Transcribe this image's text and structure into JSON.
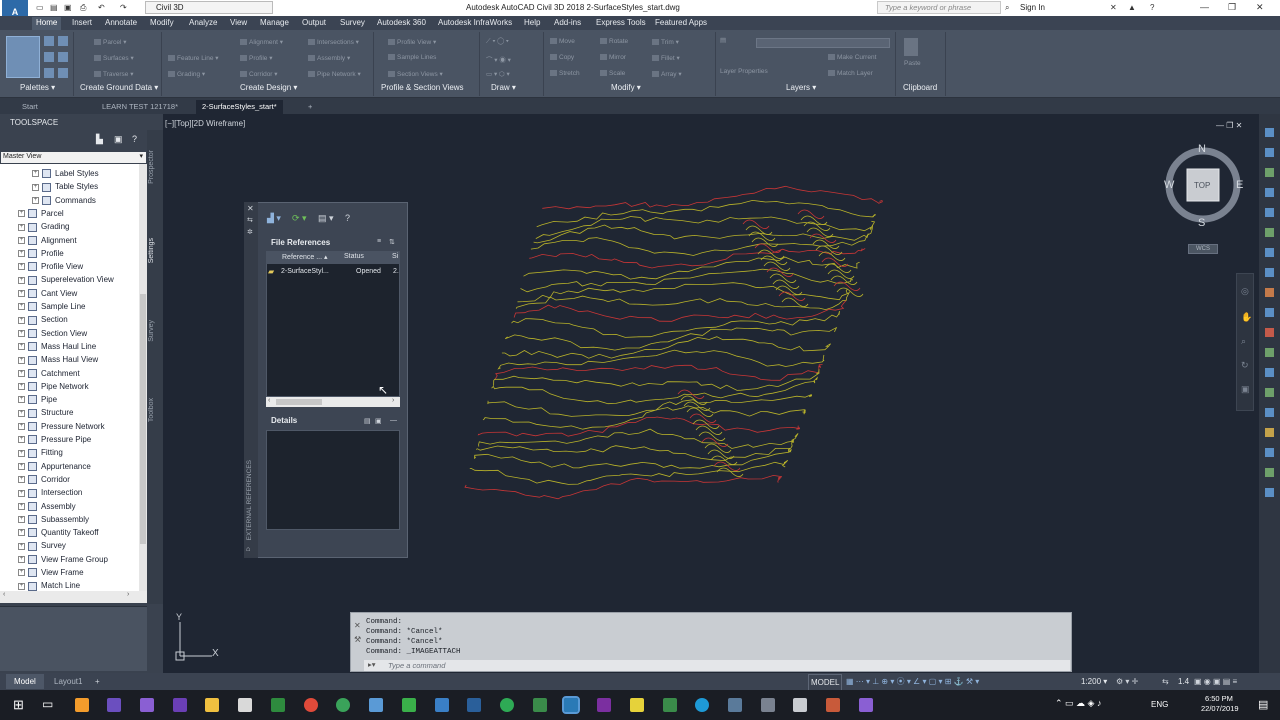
{
  "titlebar": {
    "logo": "A",
    "logo_sub": "CIVIL",
    "workspace": "Civil 3D",
    "title": "Autodesk AutoCAD Civil 3D 2018    2-SurfaceStyles_start.dwg",
    "search_placeholder": "Type a keyword or phrase",
    "sign_in": "Sign In"
  },
  "menu": {
    "tabs": [
      "Home",
      "Insert",
      "Annotate",
      "Modify",
      "Analyze",
      "View",
      "Manage",
      "Output",
      "Survey",
      "Autodesk 360",
      "Autodesk InfraWorks",
      "Help",
      "Add-ins",
      "Express Tools",
      "Featured Apps"
    ]
  },
  "ribbon": {
    "buttons_1": [
      "Parcel",
      "Surfaces",
      "Traverse"
    ],
    "buttons_2": [
      "Feature Line",
      "Grading"
    ],
    "buttons_3": [
      "Alignment",
      "Profile",
      "Corridor"
    ],
    "buttons_4": [
      "Intersections",
      "Assembly",
      "Pipe Network"
    ],
    "buttons_5": [
      "Profile View",
      "Sample Lines",
      "Section Views"
    ],
    "buttons_modify": [
      "Move",
      "Copy",
      "Stretch",
      "Rotate",
      "Mirror",
      "Scale",
      "Trim",
      "Fillet",
      "Array"
    ],
    "buttons_layers": [
      "Make Current",
      "Match Layer"
    ],
    "layer_props": "Layer Properties",
    "paste": "Paste",
    "panels": [
      "Palettes",
      "Create Ground Data",
      "Create Design",
      "Profile & Section Views",
      "Draw",
      "Modify",
      "Layers",
      "Clipboard"
    ]
  },
  "doc_tabs": [
    "Start",
    "LEARN TEST 121718*",
    "2-SurfaceStyles_start*"
  ],
  "toolspace": {
    "title": "TOOLSPACE",
    "view": "Master View",
    "items": [
      "Label Styles",
      "Table Styles",
      "Commands",
      "Parcel",
      "Grading",
      "Alignment",
      "Profile",
      "Profile View",
      "Superelevation View",
      "Cant View",
      "Sample Line",
      "Section",
      "Section View",
      "Mass Haul Line",
      "Mass Haul View",
      "Catchment",
      "Pipe Network",
      "Pipe",
      "Structure",
      "Pressure Network",
      "Pressure Pipe",
      "Fitting",
      "Appurtenance",
      "Corridor",
      "Intersection",
      "Assembly",
      "Subassembly",
      "Quantity Takeoff",
      "Survey",
      "View Frame Group",
      "View Frame",
      "Match Line"
    ],
    "side_tabs": [
      "Prospector",
      "Settings",
      "Survey",
      "Toolbox"
    ]
  },
  "viewport": {
    "label": "[−][Top][2D Wireframe]",
    "cube": {
      "n": "N",
      "s": "S",
      "e": "E",
      "w": "W",
      "top": "TOP"
    },
    "wcs": "WCS",
    "ucs_x": "X",
    "ucs_y": "Y"
  },
  "xref": {
    "title": "EXTERNAL REFERENCES",
    "section": "File References",
    "columns": [
      "Reference ...",
      "Status",
      "Si"
    ],
    "row": {
      "name": "2-SurfaceStyl...",
      "status": "Opened",
      "size": "2."
    },
    "details": "Details"
  },
  "command": {
    "history": [
      "Command:",
      "Command: *Cancel*",
      "Command: *Cancel*",
      "Command: _IMAGEATTACH"
    ],
    "placeholder": "Type a command"
  },
  "status": {
    "tabs": [
      "Model",
      "Layout1"
    ],
    "mode": "MODEL",
    "scale": "1:200",
    "lw": "1.4"
  },
  "taskbar": {
    "lang": "ENG",
    "time": "6:50 PM",
    "date": "22/07/2019"
  },
  "colors": {
    "contour_major": "#c93636",
    "contour_minor": "#b9b32a",
    "accent": "#2d6aa8"
  }
}
